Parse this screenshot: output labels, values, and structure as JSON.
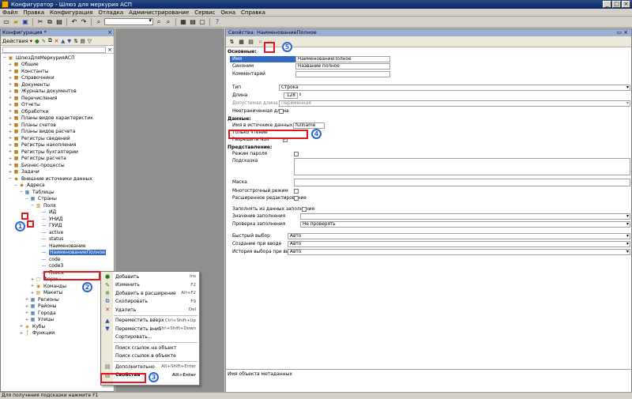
{
  "window": {
    "title": "Конфигуратор - Шлюз для меркурия АСП"
  },
  "menu": [
    "Файл",
    "Правка",
    "Конфигурация",
    "Отладка",
    "Администрирование",
    "Сервис",
    "Окна",
    "Справка"
  ],
  "config_panel": {
    "title": "Конфигурация *",
    "actions_label": "Действия ▾",
    "tree": [
      {
        "label": "ШлюзДляМеркурияАСП",
        "depth": 0,
        "icon": "config-icon"
      },
      {
        "label": "Общие",
        "depth": 1,
        "icon": "common-icon"
      },
      {
        "label": "Константы",
        "depth": 1,
        "icon": "constants-icon"
      },
      {
        "label": "Справочники",
        "depth": 1,
        "icon": "catalogs-icon"
      },
      {
        "label": "Документы",
        "depth": 1,
        "icon": "documents-icon"
      },
      {
        "label": "Журналы документов",
        "depth": 1,
        "icon": "journal-icon"
      },
      {
        "label": "Перечисления",
        "depth": 1,
        "icon": "enum-icon"
      },
      {
        "label": "Отчеты",
        "depth": 1,
        "icon": "reports-icon"
      },
      {
        "label": "Обработки",
        "depth": 1,
        "icon": "processing-icon"
      },
      {
        "label": "Планы видов характеристик",
        "depth": 1,
        "icon": "chart-char-icon"
      },
      {
        "label": "Планы счетов",
        "depth": 1,
        "icon": "accounts-icon"
      },
      {
        "label": "Планы видов расчета",
        "depth": 1,
        "icon": "calc-types-icon"
      },
      {
        "label": "Регистры сведений",
        "depth": 1,
        "icon": "info-reg-icon"
      },
      {
        "label": "Регистры накопления",
        "depth": 1,
        "icon": "accum-reg-icon"
      },
      {
        "label": "Регистры бухгалтерии",
        "depth": 1,
        "icon": "acc-reg-icon"
      },
      {
        "label": "Регистры расчета",
        "depth": 1,
        "icon": "calc-reg-icon"
      },
      {
        "label": "Бизнес-процессы",
        "depth": 1,
        "icon": "bp-icon"
      },
      {
        "label": "Задачи",
        "depth": 1,
        "icon": "tasks-icon"
      },
      {
        "label": "Внешние источники данных",
        "depth": 1,
        "icon": "ext-src-icon"
      },
      {
        "label": "Адреса",
        "depth": 2,
        "icon": "address-icon"
      },
      {
        "label": "Таблицы",
        "depth": 3,
        "icon": "tables-icon"
      },
      {
        "label": "Страны",
        "depth": 4,
        "icon": "table-icon"
      },
      {
        "label": "Поля",
        "depth": 5,
        "icon": "fields-icon"
      },
      {
        "label": "ИД",
        "depth": 6,
        "icon": "field-icon"
      },
      {
        "label": "УНИД",
        "depth": 6,
        "icon": "field-icon"
      },
      {
        "label": "ГУИД",
        "depth": 6,
        "icon": "field-icon"
      },
      {
        "label": "active",
        "depth": 6,
        "icon": "field-icon"
      },
      {
        "label": "status",
        "depth": 6,
        "icon": "field-icon"
      },
      {
        "label": "Наименование",
        "depth": 6,
        "icon": "field-icon"
      },
      {
        "label": "НаименованиеПолное",
        "depth": 6,
        "icon": "field-icon",
        "selected": true
      },
      {
        "label": "code",
        "depth": 6,
        "icon": "field-icon"
      },
      {
        "label": "code3",
        "depth": 6,
        "icon": "field-icon"
      },
      {
        "label": "Поиск",
        "depth": 6,
        "icon": "field-icon"
      },
      {
        "label": "Формы",
        "depth": 5,
        "icon": "forms-icon"
      },
      {
        "label": "Команды",
        "depth": 5,
        "icon": "commands-icon"
      },
      {
        "label": "Макеты",
        "depth": 5,
        "icon": "templates-icon"
      },
      {
        "label": "Регионы",
        "depth": 4,
        "icon": "table-icon"
      },
      {
        "label": "Районы",
        "depth": 4,
        "icon": "table-icon"
      },
      {
        "label": "Города",
        "depth": 4,
        "icon": "table-icon"
      },
      {
        "label": "Улицы",
        "depth": 4,
        "icon": "table-icon"
      },
      {
        "label": "Кубы",
        "depth": 3,
        "icon": "cubes-icon"
      },
      {
        "label": "Функции",
        "depth": 3,
        "icon": "functions-icon"
      }
    ]
  },
  "context_menu": [
    {
      "label": "Добавить",
      "shortcut": "Ins",
      "icon": "add-icon"
    },
    {
      "label": "Изменить",
      "shortcut": "F2",
      "icon": "edit-icon"
    },
    {
      "label": "Добавить в расширение",
      "shortcut": "Alt+F2",
      "icon": "extension-icon"
    },
    {
      "label": "Скопировать",
      "shortcut": "F9",
      "icon": "copy-icon"
    },
    {
      "label": "Удалить",
      "shortcut": "Del",
      "icon": "delete-icon"
    },
    {
      "sep": true
    },
    {
      "label": "Переместить вверх",
      "shortcut": "Ctrl+Shift+Up",
      "icon": "move-up-icon"
    },
    {
      "label": "Переместить вниз",
      "shortcut": "Ctrl+Shift+Down",
      "icon": "move-down-icon"
    },
    {
      "label": "Сортировать...",
      "shortcut": "",
      "icon": ""
    },
    {
      "sep": true
    },
    {
      "label": "Поиск ссылок на объект",
      "shortcut": "",
      "icon": ""
    },
    {
      "label": "Поиск ссылок в объекте",
      "shortcut": "",
      "icon": ""
    },
    {
      "sep": true
    },
    {
      "label": "Дополнительно",
      "shortcut": "Alt+Shift+Enter",
      "icon": "more-icon"
    },
    {
      "label": "Свойства",
      "shortcut": "Alt+Enter",
      "icon": "properties-icon",
      "bold": true
    }
  ],
  "properties": {
    "title": "Свойства: НаименованиеПолное",
    "sections": {
      "basic": "Основные:",
      "data": "Данные:",
      "presentation": "Представление:"
    },
    "name_label": "Имя",
    "name_value": "НаименованиеПолное",
    "synonym_label": "Синоним",
    "synonym_value": "Название полное",
    "comment_label": "Комментарий",
    "type_label": "Тип",
    "type_value": "Строка",
    "length_label": "Длина",
    "length_value": "128",
    "allowed_length_label": "Допустимая длина",
    "allowed_length_value": "Переменная",
    "unlimited_label": "Неограниченная длина",
    "source_name_label": "Имя в источнике данных",
    "source_name_value": "fullname",
    "readonly_label": "Только чтение",
    "allow_null_label": "Разрешить Null",
    "password_mode_label": "Режим пароля",
    "tooltip_label": "Подсказка",
    "mask_label": "Маска",
    "multiline_label": "Многострочный режим",
    "ext_edit_label": "Расширенное редактирование",
    "fill_from_data_label": "Заполнять из данных заполнения",
    "fill_value_label": "Значение заполнения",
    "fill_check_label": "Проверка заполнения",
    "fill_check_value": "Не проверять",
    "quick_choice_label": "Быстрый выбор",
    "quick_choice_value": "Авто",
    "create_on_input_label": "Создание при вводе",
    "create_on_input_value": "Авто",
    "history_label": "История выбора при вводе",
    "history_value": "Авто",
    "bottom_hint": "Имя объекта метаданных"
  },
  "statusbar": "Для получения подсказки нажмите F1",
  "annotations": [
    "1",
    "2",
    "3",
    "4",
    "5"
  ]
}
